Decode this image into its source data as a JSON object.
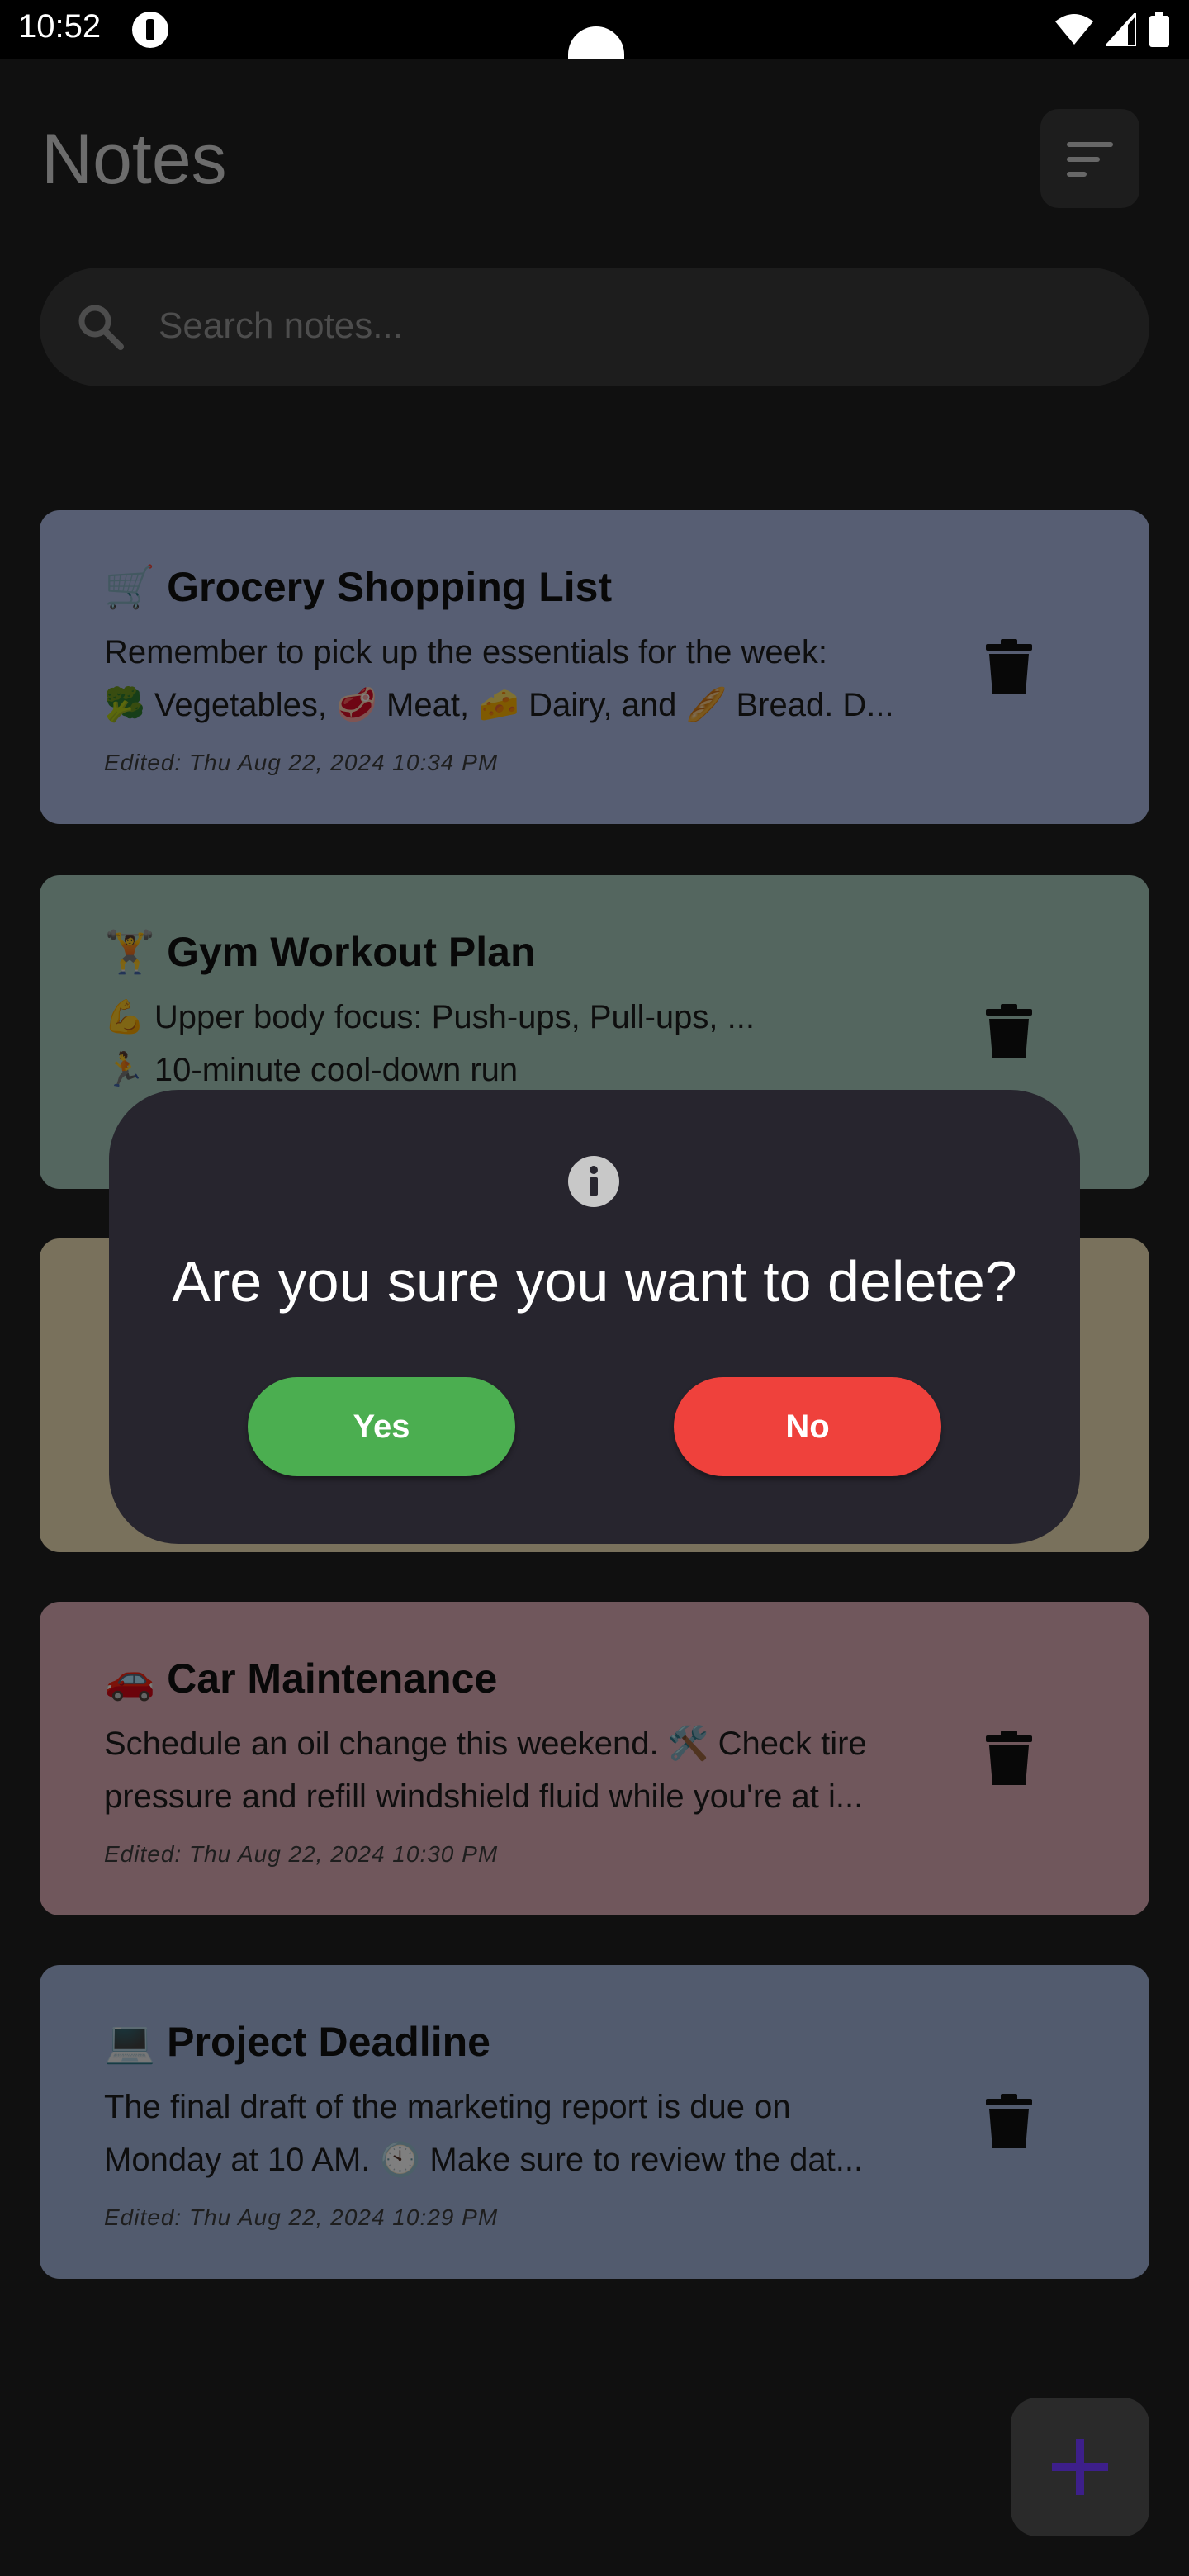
{
  "status_bar": {
    "time": "10:52"
  },
  "header": {
    "title": "Notes"
  },
  "search": {
    "placeholder": "Search notes..."
  },
  "notes": [
    {
      "title": "🛒 Grocery Shopping List",
      "body_line1": "Remember to pick up the essentials for the week:",
      "body_line2": "🥦 Vegetables, 🥩 Meat, 🧀 Dairy, and 🥖 Bread. D...",
      "date": "Edited: Thu Aug 22, 2024 10:34 PM",
      "color": "#aebde6"
    },
    {
      "title": "🏋️ Gym Workout Plan",
      "body_line1": "💪 Upper body focus: Push-ups, Pull-ups, ...",
      "body_line2": "🏃 10-minute cool-down run",
      "date": "",
      "color": "#a8ccbf"
    },
    {
      "title": "",
      "body_line1": "",
      "body_line2": "",
      "date": "",
      "color": "#f2e2b9"
    },
    {
      "title": "🚗 Car Maintenance",
      "body_line1": "Schedule an oil change this weekend. 🛠️ Check tire",
      "body_line2": "pressure and refill windshield fluid while you're at i...",
      "date": "Edited: Thu Aug 22, 2024 10:30 PM",
      "color": "#e0aeb8"
    },
    {
      "title": "💻 Project Deadline",
      "body_line1": "The final draft of the marketing report is due on",
      "body_line2": "Monday at 10 AM. 🕙 Make sure to review the dat...",
      "date": "Edited: Thu Aug 22, 2024 10:29 PM",
      "color": "#a5b6dc"
    }
  ],
  "dialog": {
    "message": "Are you sure you want to delete?",
    "yes_label": "Yes",
    "no_label": "No",
    "yes_color": "#4bae50",
    "no_color": "#ef413c"
  },
  "icons": [
    "sort-icon",
    "search-icon",
    "trash-icon",
    "info-icon",
    "plus-icon",
    "wifi-icon",
    "signal-icon",
    "battery-icon"
  ],
  "colors": {
    "background": "#0e0e0e",
    "dialog": "#27252e",
    "fab_plus": "#3d1f8a"
  }
}
